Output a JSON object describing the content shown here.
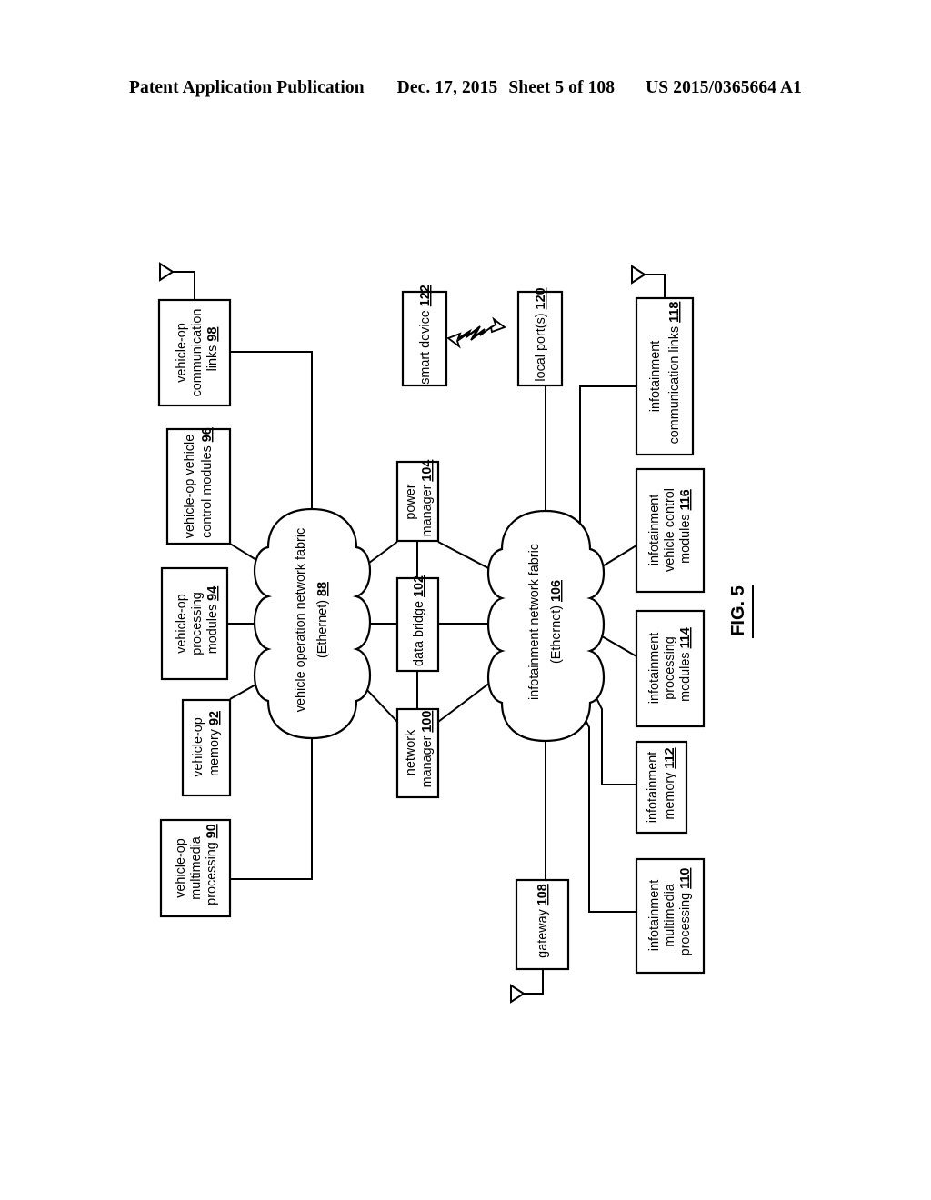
{
  "header": {
    "publication": "Patent Application Publication",
    "date": "Dec. 17, 2015",
    "sheet": "Sheet 5 of 108",
    "patent_number": "US 2015/0365664 A1"
  },
  "figure": {
    "label": "FIG. 5",
    "vehicle_cloud": {
      "line1": "vehicle operation network fabric",
      "line2": "(Ethernet) ",
      "ref": "88"
    },
    "infotainment_cloud": {
      "line1": "infotainment network fabric",
      "line2": "(Ethernet) ",
      "ref": "106"
    },
    "boxes": {
      "b98": {
        "l1": "vehicle-op",
        "l2": "communication",
        "l3": "links ",
        "ref": "98"
      },
      "b96": {
        "l1": "vehicle-op vehicle",
        "l2": "control modules ",
        "ref": "96"
      },
      "b94": {
        "l1": "vehicle-op",
        "l2": "processing",
        "l3": "modules ",
        "ref": "94"
      },
      "b92": {
        "l1": "vehicle-op",
        "l2": "memory ",
        "ref": "92"
      },
      "b90": {
        "l1": "vehicle-op",
        "l2": "multimedia",
        "l3": "processing ",
        "ref": "90"
      },
      "b104": {
        "l1": "power",
        "l2": "manager ",
        "ref": "104"
      },
      "b102": {
        "l1": "data bridge ",
        "ref": "102"
      },
      "b100": {
        "l1": "network",
        "l2": "manager ",
        "ref": "100"
      },
      "b122": {
        "l1": "smart device ",
        "ref": "122"
      },
      "b120": {
        "l1": "local port(s) ",
        "ref": "120"
      },
      "b118": {
        "l1": "infotainment",
        "l2": "communication links ",
        "ref": "118"
      },
      "b116": {
        "l1": "infotainment",
        "l2": "vehicle control",
        "l3": "modules ",
        "ref": "116"
      },
      "b114": {
        "l1": "infotainment",
        "l2": "processing",
        "l3": "modules ",
        "ref": "114"
      },
      "b112": {
        "l1": "infotainment",
        "l2": "memory ",
        "ref": "112"
      },
      "b110": {
        "l1": "infotainment",
        "l2": "multimedia",
        "l3": "processing ",
        "ref": "110"
      },
      "b108": {
        "l1": "gateway ",
        "ref": "108"
      }
    },
    "icons": {
      "antenna_vehicle": "antenna-icon",
      "antenna_infotainment": "antenna-icon",
      "antenna_gateway": "antenna-icon",
      "wireless_link": "wireless-lightning-icon"
    },
    "colors": {
      "stroke": "#000000",
      "fill": "#ffffff"
    }
  }
}
